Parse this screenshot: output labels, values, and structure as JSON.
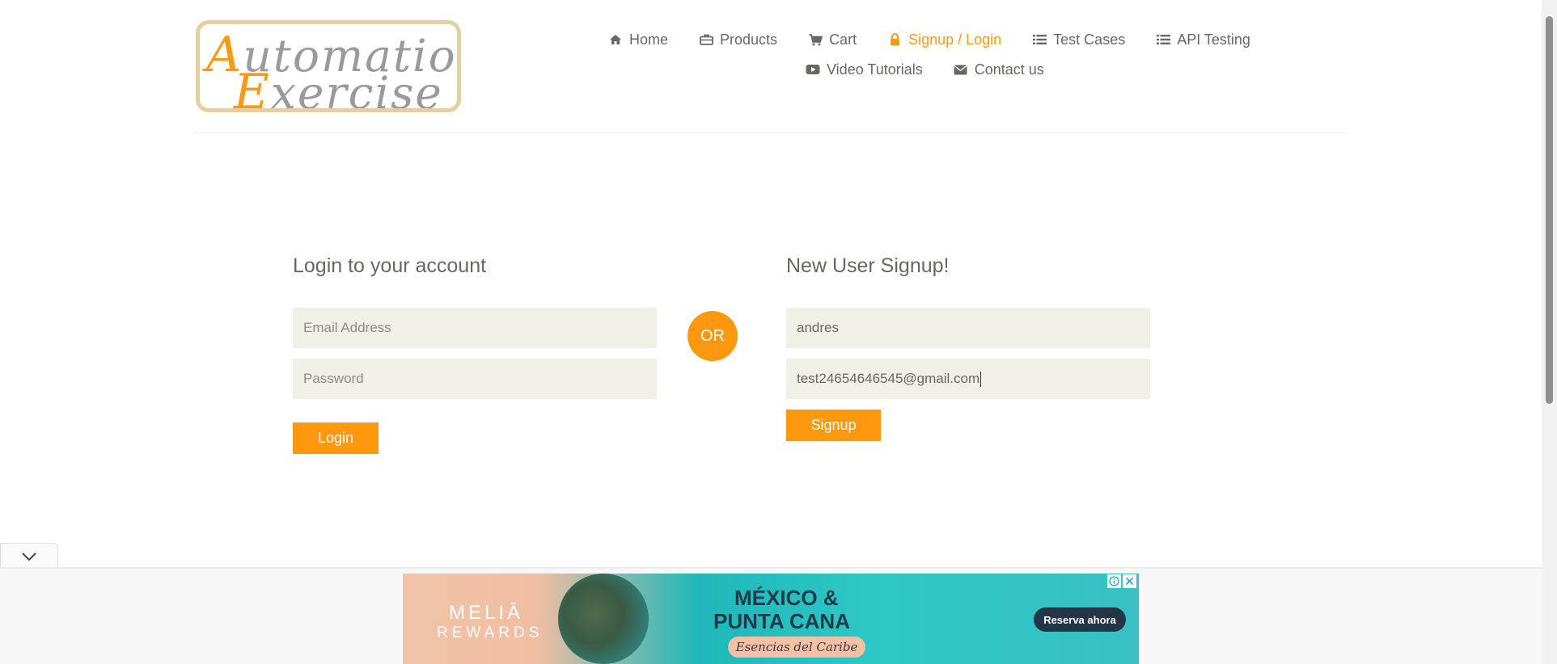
{
  "logo": {
    "line1_cap": "A",
    "line1_rest": "utomation",
    "line2_cap": "E",
    "line2_rest": "xercise"
  },
  "nav": {
    "row1": [
      {
        "label": "Home",
        "icon": "home-icon"
      },
      {
        "label": "Products",
        "icon": "briefcase-icon"
      },
      {
        "label": "Cart",
        "icon": "cart-icon"
      },
      {
        "label": "Signup / Login",
        "icon": "lock-icon",
        "active": true
      },
      {
        "label": "Test Cases",
        "icon": "list-icon"
      },
      {
        "label": "API Testing",
        "icon": "list-icon"
      }
    ],
    "row2": [
      {
        "label": "Video Tutorials",
        "icon": "youtube-icon"
      },
      {
        "label": "Contact us",
        "icon": "envelope-icon"
      }
    ]
  },
  "login": {
    "title": "Login to your account",
    "email_placeholder": "Email Address",
    "password_placeholder": "Password",
    "button_label": "Login"
  },
  "separator": {
    "label": "OR"
  },
  "signup": {
    "title": "New User Signup!",
    "name_value": "andres",
    "email_value": "test24654646545@gmail.com",
    "button_label": "Signup"
  },
  "ad": {
    "brand_line1": "MELIĀ",
    "brand_line2": "REWARDS",
    "headline1": "MÉXICO &",
    "headline2": "PUNTA CANA",
    "tagline": "Esencias del Caribe",
    "cta_label": "Reserva ahora"
  },
  "colors": {
    "accent": "#fe980f",
    "text": "#696763",
    "field_bg": "#f0f0e9"
  }
}
